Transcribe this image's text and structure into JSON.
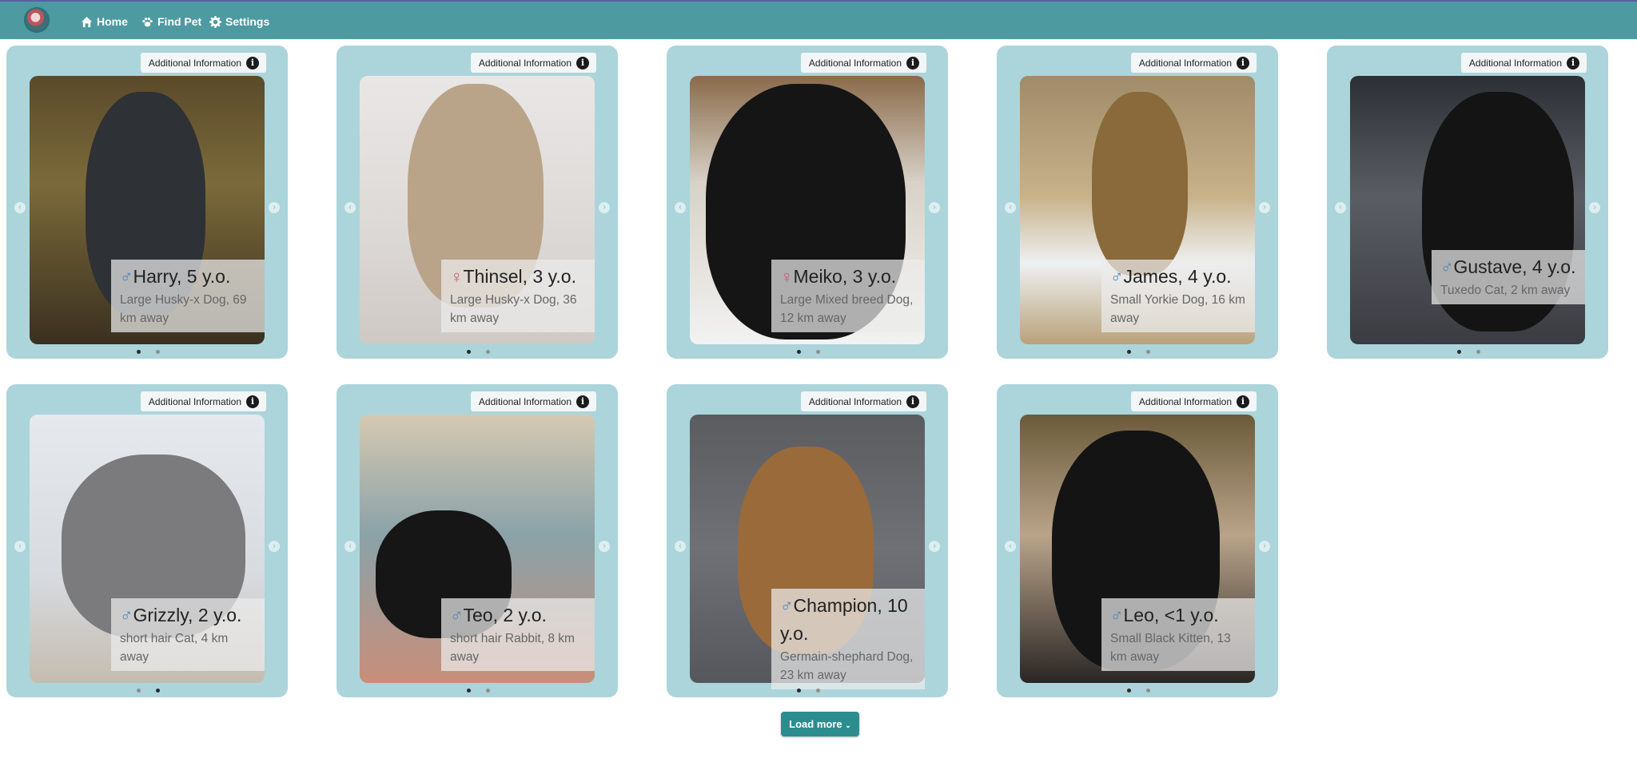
{
  "nav": {
    "items": [
      {
        "label": "Home",
        "icon": "home-icon"
      },
      {
        "label": "Find Pet",
        "icon": "paw-icon"
      },
      {
        "label": "Settings",
        "icon": "gear-icon"
      }
    ]
  },
  "info_button_label": "Additional Information",
  "pets": [
    {
      "name": "Harry, 5 y.o.",
      "sex": "male",
      "description": "Large Husky-x Dog, 69 km away",
      "active_slide": 1,
      "slides": 2
    },
    {
      "name": "Thinsel, 3 y.o.",
      "sex": "female",
      "description": "Large Husky-x Dog, 36 km away",
      "active_slide": 1,
      "slides": 2
    },
    {
      "name": "Meiko, 3 y.o.",
      "sex": "female",
      "description": "Large Mixed breed Dog, 12 km away",
      "active_slide": 1,
      "slides": 2
    },
    {
      "name": "James, 4 y.o.",
      "sex": "male",
      "description": "Small Yorkie Dog, 16 km away",
      "active_slide": 1,
      "slides": 2
    },
    {
      "name": "Gustave, 4 y.o.",
      "sex": "male",
      "description": "Tuxedo Cat, 2 km away",
      "active_slide": 1,
      "slides": 2
    },
    {
      "name": "Grizzly, 2 y.o.",
      "sex": "male",
      "description": "short hair Cat, 4 km away",
      "active_slide": 2,
      "slides": 2
    },
    {
      "name": "Teo, 2 y.o.",
      "sex": "male",
      "description": "short hair Rabbit, 8 km away",
      "active_slide": 1,
      "slides": 2
    },
    {
      "name": "Champion, 10 y.o.",
      "sex": "male",
      "description": "Germain-shephard Dog, 23 km away",
      "active_slide": 1,
      "slides": 2
    },
    {
      "name": "Leo, <1 y.o.",
      "sex": "male",
      "description": "Small Black Kitten, 13 km away",
      "active_slide": 1,
      "slides": 2
    }
  ],
  "sex_symbols": {
    "male": "♂",
    "female": "♀"
  },
  "load_more_label": "Load more",
  "load_more_icon": "chevron-down-icon",
  "colors": {
    "navbar": "#4e9aa1",
    "card": "#abd5da",
    "load_more": "#2c8d8f"
  }
}
